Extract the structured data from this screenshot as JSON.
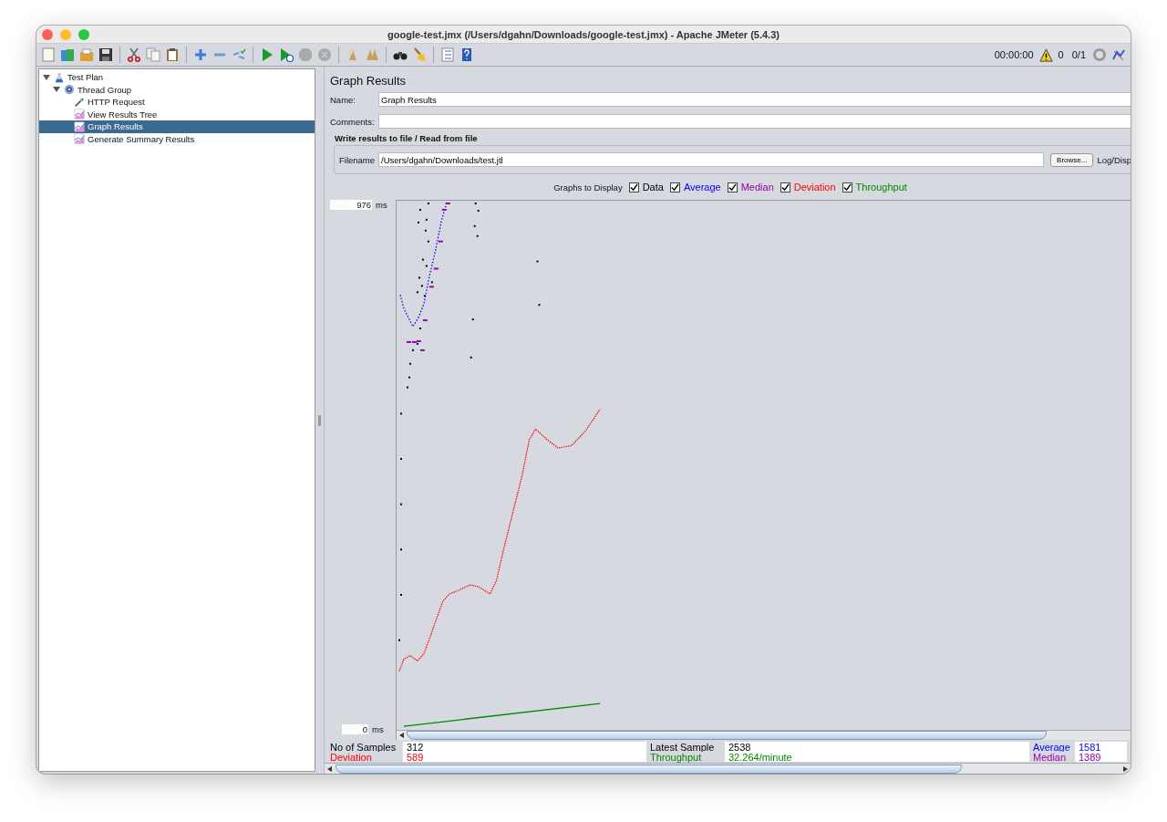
{
  "window": {
    "title": "google-test.jmx (/Users/dgahn/Downloads/google-test.jmx) - Apache JMeter (5.4.3)"
  },
  "toolbar": {
    "timer": "00:00:00",
    "warnings": "0",
    "threads": "0/1"
  },
  "tree": {
    "items": [
      {
        "label": "Test Plan",
        "kind": "plan",
        "expanded": true,
        "selected": false,
        "children": [
          {
            "label": "Thread Group",
            "kind": "group",
            "expanded": true,
            "selected": false,
            "children": [
              {
                "label": "HTTP Request",
                "kind": "sampler",
                "selected": false
              },
              {
                "label": "View Results Tree",
                "kind": "listener",
                "selected": false
              },
              {
                "label": "Graph Results",
                "kind": "listener",
                "selected": true
              },
              {
                "label": "Generate Summary Results",
                "kind": "listener",
                "selected": false
              }
            ]
          }
        ]
      }
    ]
  },
  "panel": {
    "title": "Graph Results",
    "name_label": "Name:",
    "name_value": "Graph Results",
    "comments_label": "Comments:",
    "file_group": {
      "title": "Write results to file / Read from file",
      "filename_label": "Filename",
      "filename_value": "/Users/dgahn/Downloads/test.jtl",
      "browse_button": "Browse...",
      "log_label": "Log/Disp"
    },
    "graphs_label": "Graphs to Display",
    "graphs": [
      {
        "label": "Data",
        "checked": true,
        "color": "#000000"
      },
      {
        "label": "Average",
        "checked": true,
        "color": "#0000ff"
      },
      {
        "label": "Median",
        "checked": true,
        "color": "#9900aa"
      },
      {
        "label": "Deviation",
        "checked": true,
        "color": "#ff0000"
      },
      {
        "label": "Throughput",
        "checked": true,
        "color": "#008800"
      }
    ],
    "graph": {
      "y_max": "976",
      "y_min": "0",
      "unit_top": "ms",
      "unit_bottom": "ms"
    },
    "stats": [
      {
        "label": "No of Samples",
        "value": "312",
        "color": "#000000"
      },
      {
        "label": "Latest Sample",
        "value": "2538",
        "color": "#000000"
      },
      {
        "label": "Average",
        "value": "1581",
        "color": "#0000ff"
      },
      {
        "label": "Deviation",
        "value": "589",
        "color": "#ff0000"
      },
      {
        "label": "Throughput",
        "value": "32.264/minute",
        "color": "#008800"
      },
      {
        "label": "Median",
        "value": "1389",
        "color": "#9900aa"
      }
    ]
  }
}
